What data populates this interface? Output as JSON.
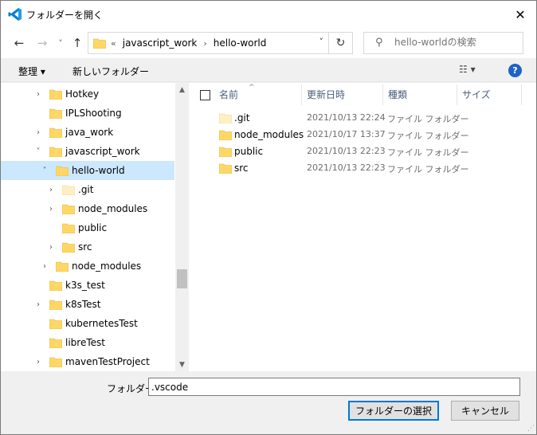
{
  "window": {
    "title": "フォルダーを開く",
    "close_glyph": "✕"
  },
  "nav": {
    "back_glyph": "←",
    "forward_glyph": "→",
    "recent_glyph": "˅",
    "up_glyph": "↑",
    "address": {
      "crumbs": [
        "javascript_work",
        "hello-world"
      ],
      "overflow": "«",
      "separator": "›",
      "dropdown_glyph": "˅",
      "refresh_glyph": "↻"
    },
    "search_placeholder": "hello-worldの検索",
    "search_glyph": "⚲"
  },
  "commands": {
    "organize_label": "整理 ▾",
    "new_folder_label": "新しいフォルダー",
    "view_glyph": "☷ ▾",
    "help_glyph": "?"
  },
  "tree": {
    "items": [
      {
        "label": "Hotkey",
        "chevron": "›"
      },
      {
        "label": "IPLShooting",
        "chevron": ""
      },
      {
        "label": "java_work",
        "chevron": "›"
      },
      {
        "label": "javascript_work",
        "chevron": "˅"
      },
      {
        "label": "hello-world",
        "chevron": "˅"
      },
      {
        "label": ".git",
        "chevron": "›"
      },
      {
        "label": "node_modules",
        "chevron": "›"
      },
      {
        "label": "public",
        "chevron": ""
      },
      {
        "label": "src",
        "chevron": "›"
      },
      {
        "label": "node_modules",
        "chevron": "›"
      },
      {
        "label": "k3s_test",
        "chevron": ""
      },
      {
        "label": "k8sTest",
        "chevron": "›"
      },
      {
        "label": "kubernetesTest",
        "chevron": ""
      },
      {
        "label": "libreTest",
        "chevron": ""
      },
      {
        "label": "mavenTestProject",
        "chevron": "›"
      }
    ],
    "scroll_up_glyph": "▲",
    "scroll_down_glyph": "▼"
  },
  "list": {
    "columns": {
      "name": "名前",
      "date": "更新日時",
      "type": "種類",
      "size": "サイズ"
    },
    "sort_glyph": "^",
    "rows": [
      {
        "name": ".git",
        "date": "2021/10/13 22:24",
        "type": "ファイル フォルダー"
      },
      {
        "name": "node_modules",
        "date": "2021/10/17 13:37",
        "type": "ファイル フォルダー"
      },
      {
        "name": "public",
        "date": "2021/10/13 22:23",
        "type": "ファイル フォルダー"
      },
      {
        "name": "src",
        "date": "2021/10/13 22:23",
        "type": "ファイル フォルダー"
      }
    ]
  },
  "footer": {
    "folder_label": "フォルダー:",
    "folder_value": ".vscode",
    "select_button": "フォルダーの選択",
    "cancel_button": "キャンセル",
    "grip_glyph": "⋰"
  },
  "colors": {
    "selected": "#cce8ff",
    "folder": "#ffd766",
    "accent": "#0078d7",
    "header_text": "#4c607a"
  }
}
